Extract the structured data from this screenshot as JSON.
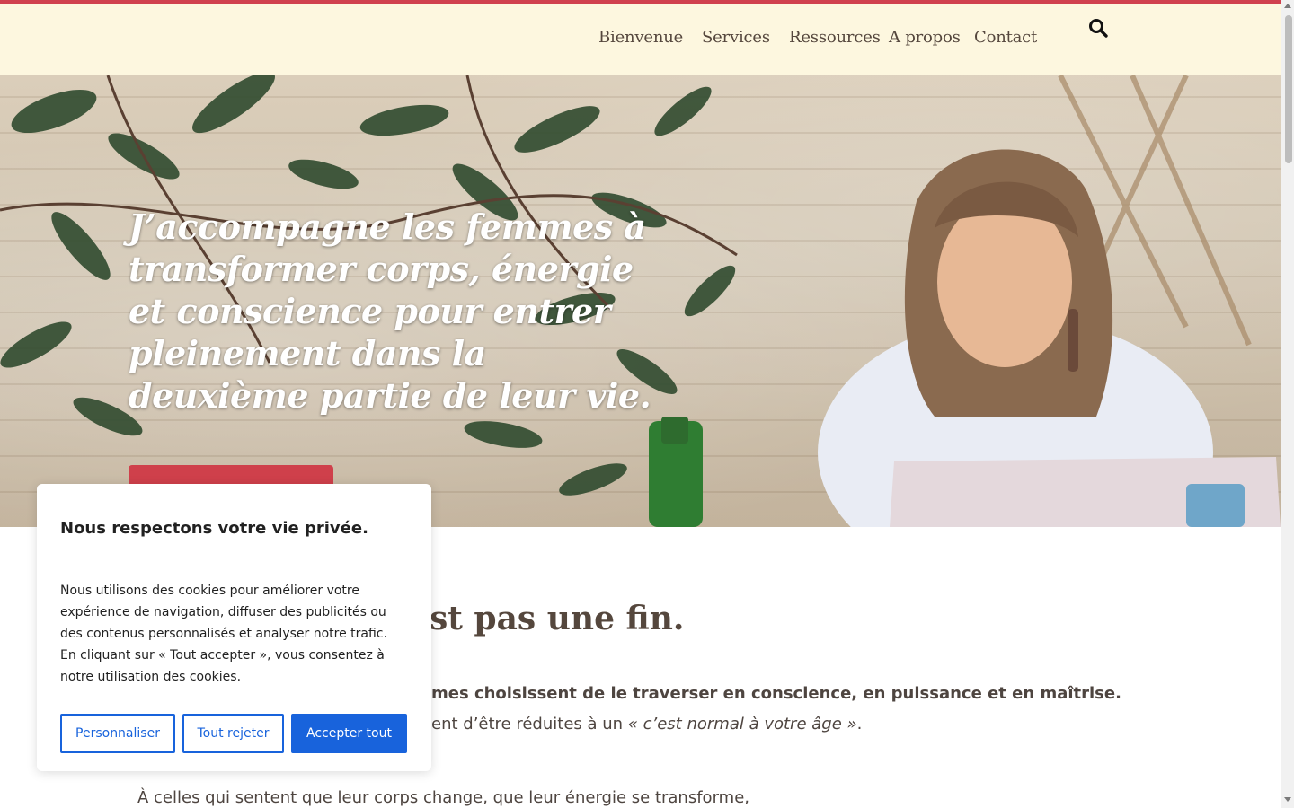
{
  "nav": {
    "items": [
      "Bienvenue",
      "Services",
      "Ressources",
      "A propos",
      "Contact"
    ]
  },
  "hero": {
    "title": "J’accompagne les femmes à transformer corps, énergie et conscience pour entrer pleinement dans la deuxième partie de leur vie."
  },
  "content": {
    "heading_visible": "st pas une fin.",
    "para_bold_visible": "mes choisissent de le traverser en conscience, en puissance et en maîtrise.",
    "para_line2_visible": "ent d’être réduites à un ",
    "para_line2_quote": "« c’est normal à votre âge »",
    "para_line2_end": ".",
    "para_line3": "À celles qui sentent que leur corps change, que leur énergie se transforme,"
  },
  "cookie_banner": {
    "title": "Nous respectons votre vie privée.",
    "text": "Nous utilisons des cookies pour améliorer votre expérience de navigation, diffuser des publicités ou des contenus personnalisés et analyser notre trafic. En cliquant sur « Tout accepter », vous consentez à notre utilisation des cookies.",
    "customize_label": "Personnaliser",
    "reject_label": "Tout rejeter",
    "accept_label": "Accepter tout"
  },
  "colors": {
    "accent_red": "#d0414e",
    "header_bg": "#fdf7df",
    "cookie_blue": "#1863dc"
  },
  "icons": {
    "search": "search-icon"
  }
}
